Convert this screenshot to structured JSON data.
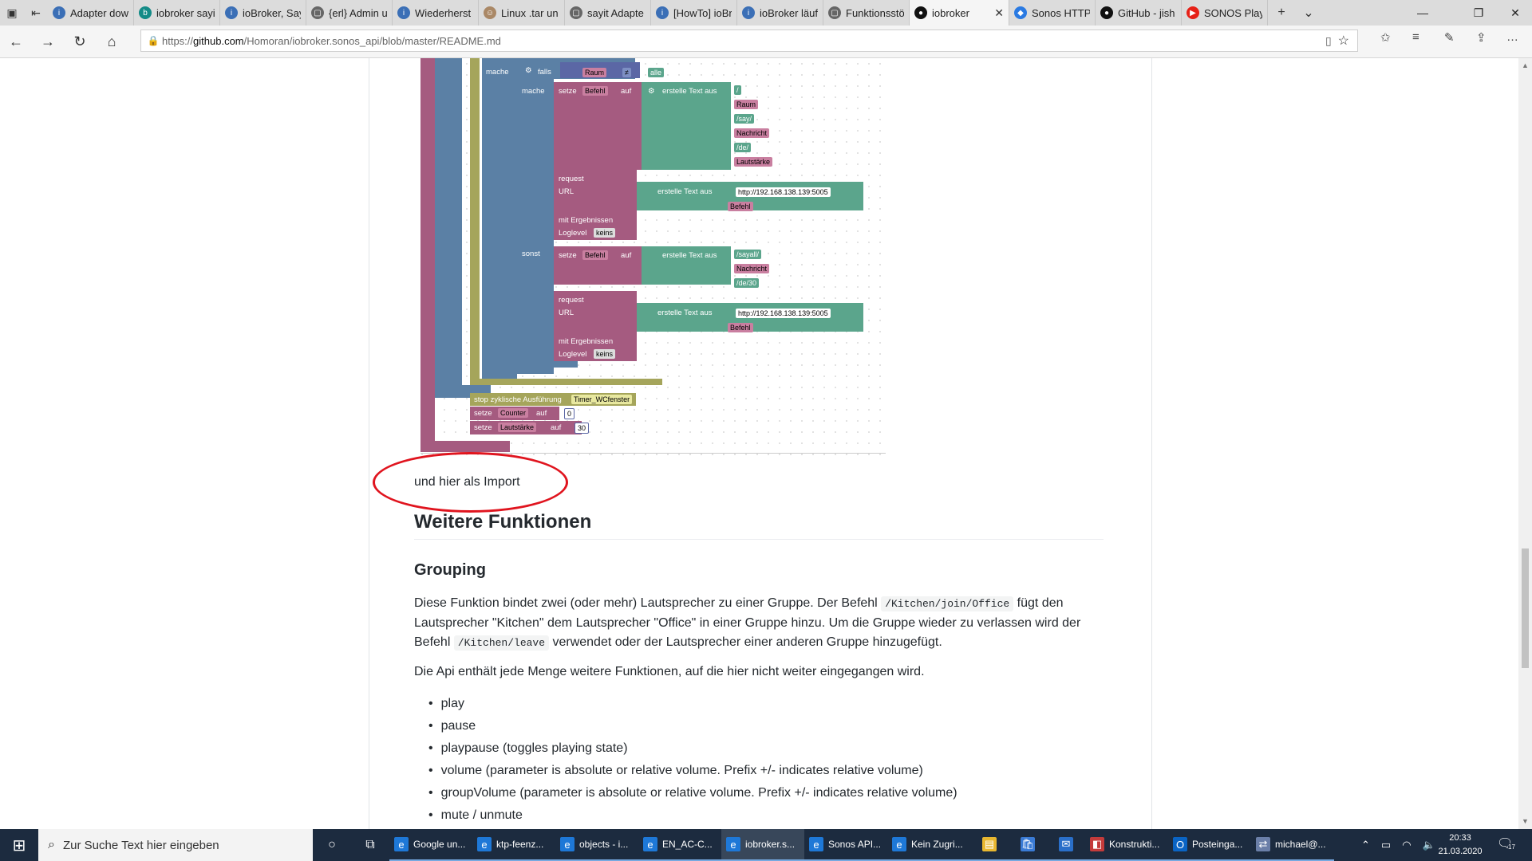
{
  "tabs": [
    {
      "label": "Adapter dow",
      "icon": "info-icon",
      "color": "#3b6fb6"
    },
    {
      "label": "iobroker sayi",
      "icon": "bing-icon",
      "color": "#138b87"
    },
    {
      "label": "ioBroker, Say",
      "icon": "info-icon",
      "color": "#3b6fb6"
    },
    {
      "label": "{erl} Admin u",
      "icon": "page-icon",
      "color": "#666666"
    },
    {
      "label": "Wiederherst",
      "icon": "info-icon",
      "color": "#3b6fb6"
    },
    {
      "label": "Linux .tar un",
      "icon": "person-icon",
      "color": "#aa8866"
    },
    {
      "label": "sayit Adapte",
      "icon": "page-icon",
      "color": "#666666"
    },
    {
      "label": "[HowTo] ioBr",
      "icon": "info-icon",
      "color": "#3b6fb6"
    },
    {
      "label": "ioBroker läuf",
      "icon": "info-icon",
      "color": "#3b6fb6"
    },
    {
      "label": "Funktionsstö",
      "icon": "page-icon",
      "color": "#666666"
    },
    {
      "label": "iobroker",
      "icon": "github-icon",
      "color": "#111111",
      "active": true
    },
    {
      "label": "Sonos HTTP",
      "icon": "sonos-icon",
      "color": "#2a7ae2"
    },
    {
      "label": "GitHub - jish",
      "icon": "github-icon",
      "color": "#111111"
    },
    {
      "label": "SONOS Play:",
      "icon": "youtube-icon",
      "color": "#e62117"
    }
  ],
  "address": {
    "prefix": "https://",
    "domain": "github.com",
    "path": "/Homoran/iobroker.sonos_api/blob/master/README.md"
  },
  "blocks": {
    "mache": "mache",
    "falls": "falls",
    "raum": "Raum",
    "neq": "≠",
    "alle": "alle",
    "mache2": "mache",
    "setze": "setze",
    "befehl": "Befehl",
    "auf": "auf",
    "erstelle": "erstelle Text aus",
    "slash": "/",
    "say": "/say/",
    "nachricht": "Nachricht",
    "de": "/de/",
    "lautstaerke": "Lautstärke",
    "request": "request",
    "url": "URL",
    "urlval": "http://192.168.138.139:5005",
    "mitergebnissen": "mit Ergebnissen",
    "loglevel": "Loglevel",
    "keins": "keins",
    "sonst": "sonst",
    "sayall": "/sayall/",
    "de30": "/de/30",
    "stop": "stop zyklische Ausführung",
    "timer": "Timer_WCfenster",
    "counter": "Counter",
    "zero": "0",
    "thirty": "30"
  },
  "readme": {
    "import_line": "und hier als Import",
    "h2": "Weitere Funktionen",
    "h3": "Grouping",
    "p1_a": "Diese Funktion bindet zwei (oder mehr) Lautsprecher zu einer Gruppe. Der Befehl ",
    "p1_code1": "/Kitchen/join/Office",
    "p1_b": " fügt den Lautsprecher \"Kitchen\" dem Lautsprecher \"Office\" in einer Gruppe hinzu. Um die Gruppe wieder zu verlassen wird der Befehl ",
    "p1_code2": "/Kitchen/leave",
    "p1_c": " verwendet oder der Lautsprecher einer anderen Gruppe hinzugefügt.",
    "p2": "Die Api enthält jede Menge weitere Funktionen, auf die hier nicht weiter eingegangen wird.",
    "list": [
      "play",
      "pause",
      "playpause (toggles playing state)",
      "volume (parameter is absolute or relative volume. Prefix +/- indicates relative volume)",
      "groupVolume (parameter is absolute or relative volume. Prefix +/- indicates relative volume)",
      "mute / unmute"
    ]
  },
  "taskbar": {
    "search_placeholder": "Zur Suche Text hier eingeben",
    "tasks": [
      {
        "label": "Google un...",
        "icon": "edge-icon"
      },
      {
        "label": "ktp-feenz...",
        "icon": "edge-icon"
      },
      {
        "label": "objects - i...",
        "icon": "edge-icon"
      },
      {
        "label": "EN_AC-C...",
        "icon": "edge-icon"
      },
      {
        "label": "iobroker.s...",
        "icon": "edge-icon",
        "active": true
      },
      {
        "label": "Sonos API...",
        "icon": "edge-icon"
      },
      {
        "label": "Kein Zugri...",
        "icon": "edge-icon"
      },
      {
        "label": "",
        "icon": "folder-icon"
      },
      {
        "label": "",
        "icon": "store-icon"
      },
      {
        "label": "",
        "icon": "mail-icon"
      },
      {
        "label": "Konstrukti...",
        "icon": "app-icon"
      },
      {
        "label": "Posteinga...",
        "icon": "outlook-icon"
      },
      {
        "label": "michael@...",
        "icon": "network-icon"
      }
    ],
    "time": "20:33",
    "date": "21.03.2020",
    "notifications": "17"
  }
}
